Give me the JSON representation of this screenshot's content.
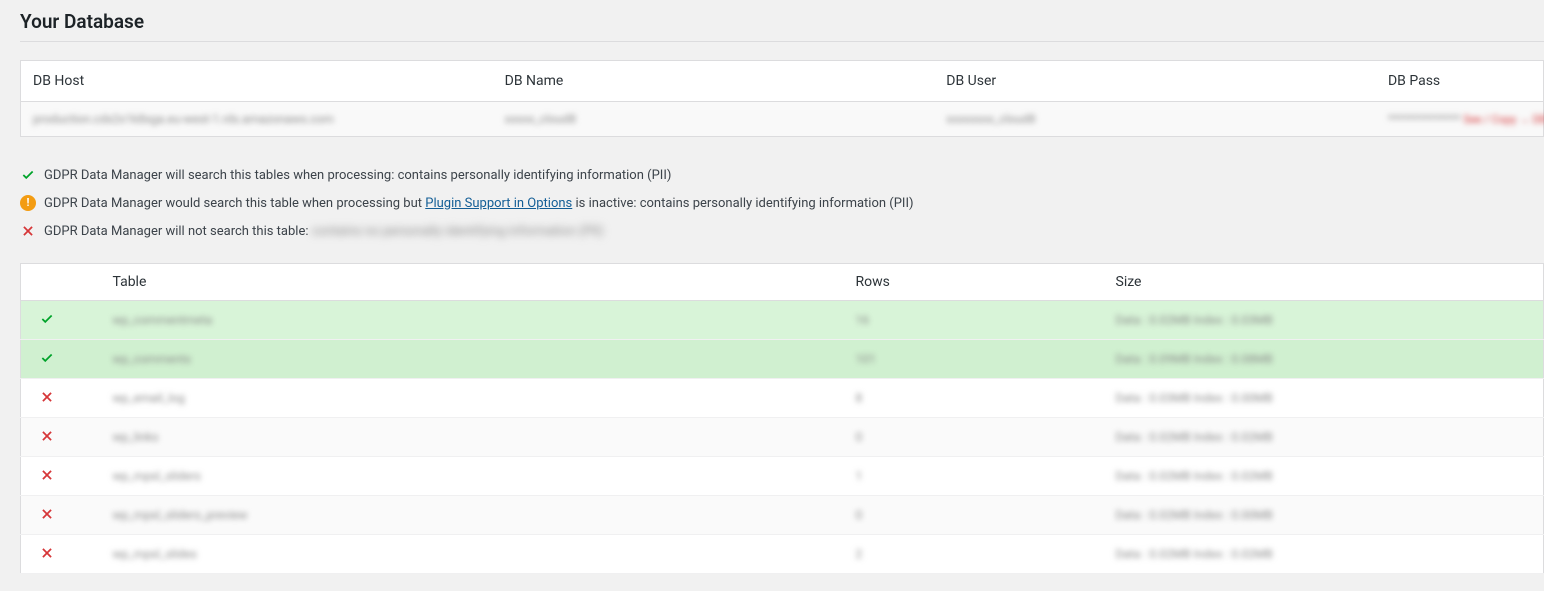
{
  "title": "Your Database",
  "connection": {
    "headers": {
      "host": "DB Host",
      "name": "DB Name",
      "user": "DB User",
      "pass": "DB Pass"
    },
    "values": {
      "host": "production.cdx2x1k8xga.eu-west-1.rds.amazonaws.com",
      "name": "xxxxx_cloud8",
      "user": "xxxxxxxx_cloud8",
      "pass_masked": "**************",
      "pass_link": "See / Copy → DB"
    }
  },
  "legend": {
    "ok_text": "GDPR Data Manager will search this tables when processing: contains personally identifying information (PII)",
    "warn_prefix": "GDPR Data Manager would search this table when processing but ",
    "warn_link": "Plugin Support in Options",
    "warn_suffix": " is inactive: contains personally identifying information (PII)",
    "no_prefix": "GDPR Data Manager will not search this table: ",
    "no_blurred": "contains no personally identifying information (PII)"
  },
  "table_headers": {
    "table": "Table",
    "rows": "Rows",
    "size": "Size"
  },
  "tables": [
    {
      "status": "ok",
      "name": "wp_commentmeta",
      "rows": "16",
      "size": "Data : 0.02MB  Index : 0.03MB"
    },
    {
      "status": "ok",
      "name": "wp_comments",
      "rows": "101",
      "size": "Data : 0.09MB  Index : 0.08MB"
    },
    {
      "status": "no",
      "name": "wp_email_log",
      "rows": "8",
      "size": "Data : 0.03MB  Index : 0.00MB"
    },
    {
      "status": "no",
      "name": "wp_links",
      "rows": "0",
      "size": "Data : 0.02MB  Index : 0.02MB"
    },
    {
      "status": "no",
      "name": "wp_mpsl_sliders",
      "rows": "1",
      "size": "Data : 0.02MB  Index : 0.02MB"
    },
    {
      "status": "no",
      "name": "wp_mpsl_sliders_preview",
      "rows": "0",
      "size": "Data : 0.02MB  Index : 0.00MB"
    },
    {
      "status": "no",
      "name": "wp_mpsl_slides",
      "rows": "2",
      "size": "Data : 0.02MB  Index : 0.02MB"
    }
  ]
}
